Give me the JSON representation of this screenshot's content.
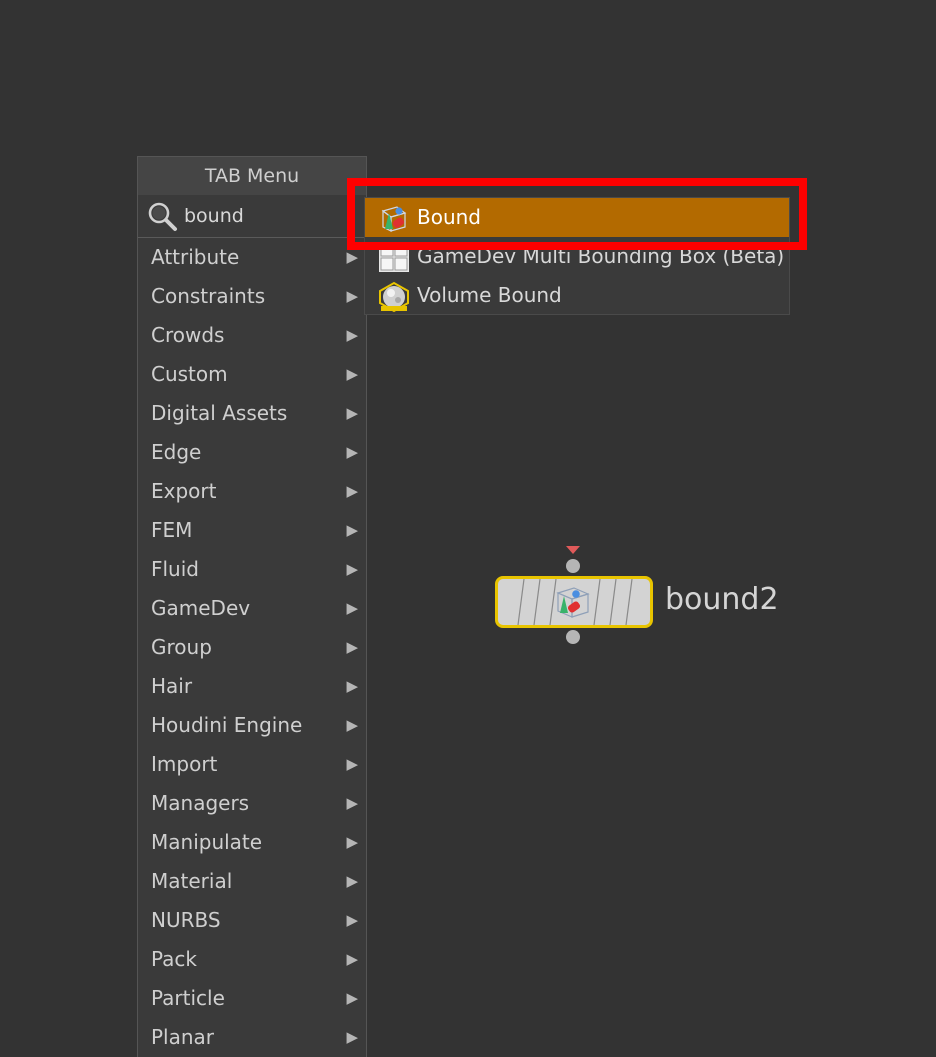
{
  "tab_menu": {
    "title": "TAB Menu",
    "search": {
      "value": "bound",
      "icon": "magnifier-icon"
    },
    "arrow_glyph": "▶",
    "categories": [
      "Attribute",
      "Constraints",
      "Crowds",
      "Custom",
      "Digital Assets",
      "Edge",
      "Export",
      "FEM",
      "Fluid",
      "GameDev",
      "Group",
      "Hair",
      "Houdini Engine",
      "Import",
      "Managers",
      "Manipulate",
      "Material",
      "NURBS",
      "Pack",
      "Particle",
      "Planar"
    ]
  },
  "results": {
    "items": [
      {
        "label": "Bound",
        "icon": "bound-sop-icon",
        "selected": true
      },
      {
        "label": "GameDev Multi Bounding Box (Beta)",
        "icon": "grid-box-icon",
        "selected": false
      },
      {
        "label": "Volume Bound",
        "icon": "volume-bound-icon",
        "selected": false
      }
    ]
  },
  "node": {
    "name": "bound2",
    "icon": "bound-sop-icon"
  },
  "colors": {
    "background": "#333333",
    "menu": "#3a3a3a",
    "selection": "#b36a00",
    "callout": "#ff0000",
    "node_outline": "#e8c400",
    "node_flag": "#e05a5a"
  }
}
